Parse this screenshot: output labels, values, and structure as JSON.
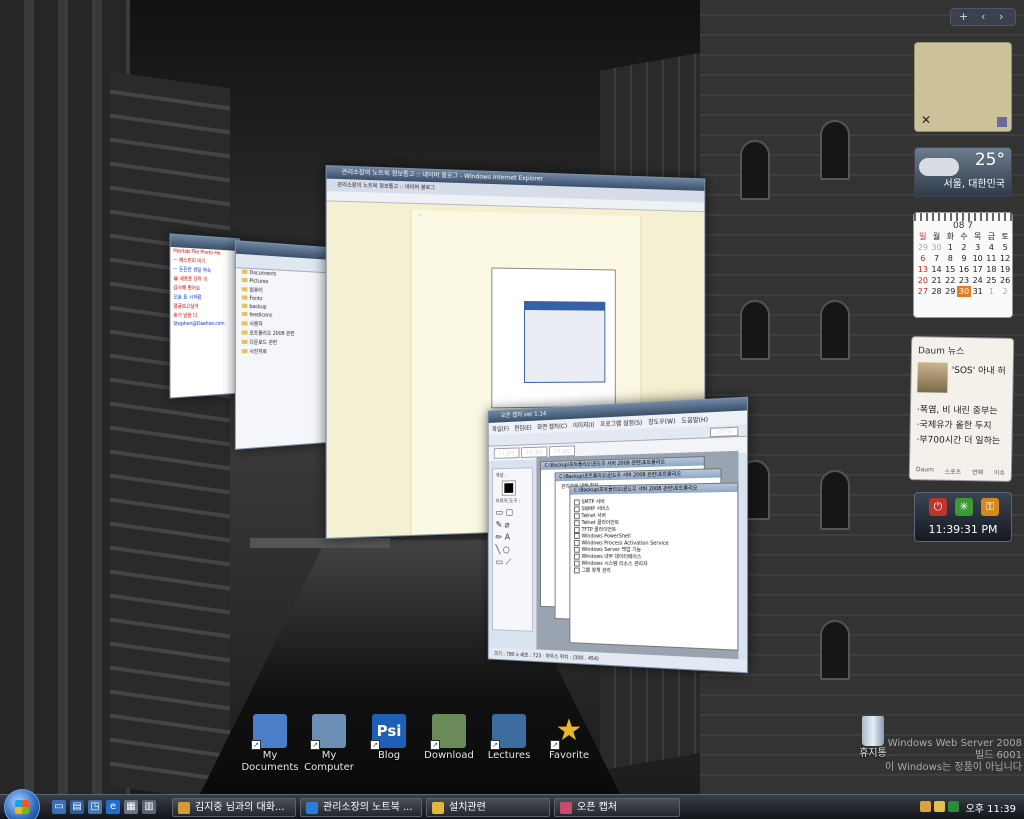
{
  "windows": {
    "messenger": {
      "lines": [
        "Hantob File Photo He",
        "ㅡ 왜스트리 비기",
        "ㅡ 든든한 생일 약속",
        "😀 세로운 단하 이",
        "감사해 봤어요",
        "오늘 표 시작럼",
        "얼굴보고싶어",
        "휴가 날을 다",
        "Stephen@Daehoo.com"
      ]
    },
    "explorer": {
      "items": [
        "Documents",
        "Pictures",
        "컴퓨터",
        "Fonts",
        "backup",
        "feedicons",
        "사용자",
        "포트폴리오 2008 관련",
        "다운로드 관련",
        "사진자료"
      ]
    },
    "ie": {
      "title": "관리소장의 노트북 정보통고 :: 네이버 블로그 - Windows Internet Explorer",
      "tab": "관리소장의 노트북 정보통고 :: 네이버 블로그"
    },
    "capture": {
      "title": "오픈 캡처 ver 1.14",
      "menu": [
        "파일(F)",
        "편집(E)",
        "화면 캡처(C)",
        "이미지(I)",
        "프로그램 설정(S)",
        "창도우(W)",
        "도움말(H)"
      ],
      "tabs": [
        "17.jpg",
        "18.jpg",
        "19.jpg"
      ],
      "side_labels": [
        "색상 :",
        "이미지 도구 :"
      ],
      "shot_title": "C:\\Backup\\포트폴리오\\윈도우 서버 2008 관련\\포트폴리오",
      "shot_heading": "관리자에 대해 확장",
      "services": [
        "SMTP 서버",
        "SNMP 서비스",
        "Telnet 서버",
        "Telnet 클라이언트",
        "TFTP 클라이언트",
        "Windows PowerShell",
        "Windows Process Activation Service",
        "Windows Server 백업 기능",
        "Windows 내부 데이터베이스",
        "Windows 시스템 리소스 관리자",
        "그룹 정책 관리"
      ],
      "zoom": "100%",
      "status": "크기 : 780 x 세로 : 723 · 마우스 위치 : (300 , 454)"
    }
  },
  "sidebar": {
    "weather": {
      "temp": "25°",
      "location": "서울, 대한민국"
    },
    "calendar": {
      "month": "08 7",
      "weekdays": [
        "일",
        "월",
        "화",
        "수",
        "목",
        "금",
        "토"
      ],
      "weeks": [
        [
          "29",
          "30",
          "1",
          "2",
          "3",
          "4",
          "5"
        ],
        [
          "6",
          "7",
          "8",
          "9",
          "10",
          "11",
          "12"
        ],
        [
          "13",
          "14",
          "15",
          "16",
          "17",
          "18",
          "19"
        ],
        [
          "20",
          "21",
          "22",
          "23",
          "24",
          "25",
          "26"
        ],
        [
          "27",
          "28",
          "29",
          "30",
          "31",
          "1",
          "2"
        ]
      ],
      "today": "30"
    },
    "news": {
      "title": "Daum 뉴스",
      "top_headline": "'SOS' 아내 허",
      "headlines": [
        "·폭염, 비 내린 중부는",
        "·국제유가 올한 두지",
        "·부700시간 더 일하는"
      ],
      "footer": [
        "Daum",
        "스포츠",
        "연예",
        "이슈"
      ]
    },
    "clock": "11:39:31 PM"
  },
  "desktop_icons": [
    {
      "label": "My Documents",
      "line2": "",
      "color": "#4a7ec9"
    },
    {
      "label": "My",
      "line2": "Computer",
      "color": "#6b8fb5"
    },
    {
      "label": "Blog",
      "line2": "",
      "color": "#1e5fb8"
    },
    {
      "label": "Download",
      "line2": "",
      "color": "#6a8a5a"
    },
    {
      "label": "Lectures",
      "line2": "",
      "color": "#3d6d9e"
    },
    {
      "label": "Favorite",
      "line2": "",
      "color": "#e9b829"
    }
  ],
  "psi_text": "Psi",
  "recycle_label": "휴지통",
  "watermark": [
    "Windows Web Server 2008",
    "빌드 6001",
    "이 Windows는 정품이 아닙니다"
  ],
  "taskbar": {
    "tasks": [
      {
        "label": "김지중 님과의 대화...",
        "icon_color": "#d39b3a"
      },
      {
        "label": "관리소장의 노트북 ...",
        "icon_color": "#2f7bd8"
      },
      {
        "label": "설치관련",
        "icon_color": "#e3b63c"
      },
      {
        "label": "오픈 캡처",
        "icon_color": "#c94a6f"
      }
    ],
    "clock": "오후 11:39"
  }
}
